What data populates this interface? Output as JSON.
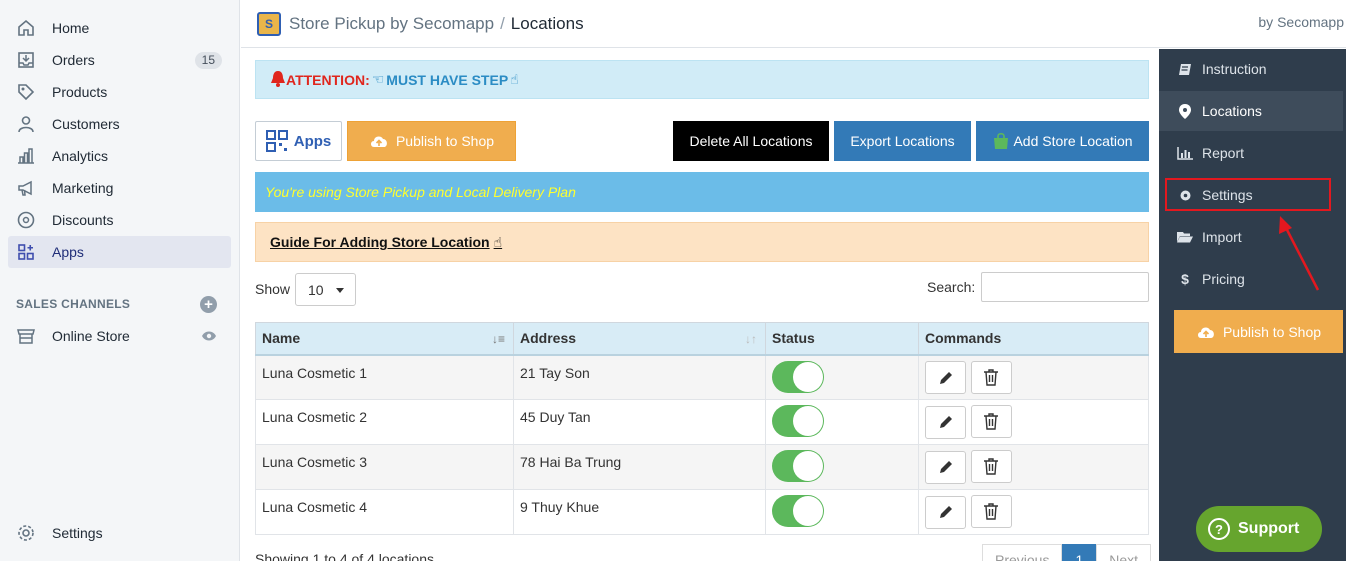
{
  "left_nav": {
    "items": [
      {
        "label": "Home",
        "icon": "home-icon"
      },
      {
        "label": "Orders",
        "icon": "orders-icon",
        "badge": "15"
      },
      {
        "label": "Products",
        "icon": "tag-icon"
      },
      {
        "label": "Customers",
        "icon": "person-icon"
      },
      {
        "label": "Analytics",
        "icon": "bar-chart-icon"
      },
      {
        "label": "Marketing",
        "icon": "megaphone-icon"
      },
      {
        "label": "Discounts",
        "icon": "discount-icon"
      },
      {
        "label": "Apps",
        "icon": "apps-icon",
        "active": true
      }
    ],
    "sales_channels_title": "SALES CHANNELS",
    "online_store": "Online Store",
    "settings": "Settings"
  },
  "header": {
    "app_name": "Store Pickup by Secomapp",
    "separator": "/",
    "page": "Locations",
    "by": "by Secomapp"
  },
  "main": {
    "attention_label": "ATTENTION:",
    "attention_text": "MUST HAVE STEP",
    "apps_button": "Apps",
    "publish_button": "Publish to Shop",
    "delete_button": "Delete All Locations",
    "export_button": "Export Locations",
    "add_button": "Add Store Location",
    "plan_text": "You're using Store Pickup and Local Delivery Plan",
    "guide_text": "Guide For Adding Store Location",
    "show_label": "Show",
    "show_value": "10",
    "search_label": "Search:",
    "table": {
      "headers": [
        "Name",
        "Address",
        "Status",
        "Commands"
      ],
      "rows": [
        {
          "name": "Luna Cosmetic 1",
          "address": "21 Tay Son"
        },
        {
          "name": "Luna Cosmetic 2",
          "address": "45 Duy Tan"
        },
        {
          "name": "Luna Cosmetic 3",
          "address": "78 Hai Ba Trung"
        },
        {
          "name": "Luna Cosmetic 4",
          "address": "9 Thuy Khue"
        }
      ]
    },
    "showing": "Showing 1 to 4 of 4 locations",
    "pager": {
      "prev": "Previous",
      "current": "1",
      "next": "Next"
    }
  },
  "right_sidebar": {
    "items": [
      "Instruction",
      "Locations",
      "Report",
      "Settings",
      "Import",
      "Pricing"
    ],
    "publish_button": "Publish to Shop",
    "support": "Support"
  },
  "colors": {
    "accent_blue": "#337ab7",
    "publish_orange": "#f0ad4e",
    "sidebar_dark": "#2f3d4c",
    "toggle_green": "#5cb85c",
    "highlight_red": "#e3181f"
  }
}
